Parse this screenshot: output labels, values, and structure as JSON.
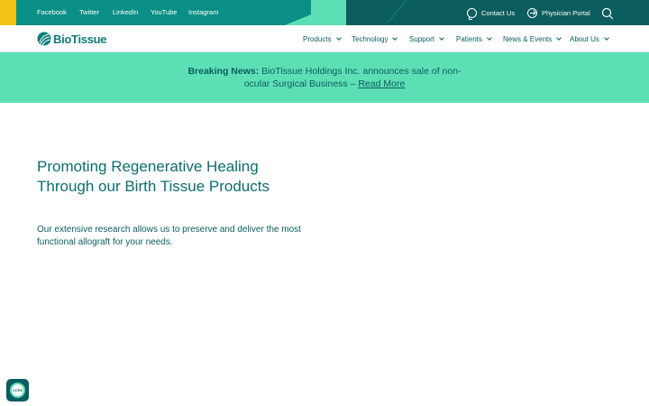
{
  "colors": {
    "topbar_teal": "#0a8f86",
    "topbar_dark": "#0b5d5e",
    "accent_yellow": "#f3c316",
    "mint": "#5ddfb5",
    "text_teal": "#0b5d5e",
    "brand_teal": "#0b7c7a"
  },
  "social_links": [
    {
      "label": "Facebook"
    },
    {
      "label": "Twitter"
    },
    {
      "label": "LinkedIn"
    },
    {
      "label": "YouTube"
    },
    {
      "label": "Instagram"
    }
  ],
  "utility": {
    "contact": {
      "label": "Contact Us",
      "icon": "headset-icon"
    },
    "portal": {
      "label": "Physician Portal",
      "icon": "arrow-circle-icon"
    },
    "search": {
      "icon": "search-icon"
    }
  },
  "brand": {
    "name": "BioTissue"
  },
  "nav": [
    {
      "label": "Products"
    },
    {
      "label": "Technology"
    },
    {
      "label": "Support"
    },
    {
      "label": "Patients"
    },
    {
      "label": "News & Events"
    },
    {
      "label": "About Us"
    }
  ],
  "news": {
    "heading": "Breaking News:",
    "body": " BioTissue Holdings Inc. announces sale of non-ocular Surgical Business – ",
    "link": "Read More"
  },
  "hero": {
    "title": "Promoting Regenerative Healing Through our Birth Tissue Products",
    "subtitle": "Our extensive research allows us to preserve and deliver the most functional allograft for your needs."
  },
  "ccpa": {
    "label": "CCPA"
  }
}
